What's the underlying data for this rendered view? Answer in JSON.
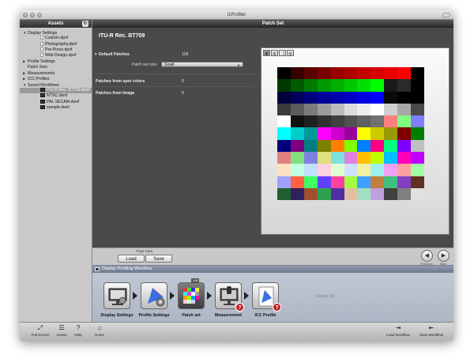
{
  "window": {
    "title": "i1Profiler"
  },
  "assets": {
    "header": "Assets",
    "refresh_icon": "↻",
    "tree": [
      {
        "label": "Display Settings",
        "indent": 0,
        "toggle": "▼",
        "icon": "none"
      },
      {
        "label": "Custom.dpxf",
        "indent": 2,
        "toggle": "",
        "icon": "file"
      },
      {
        "label": "Photography.dpxf",
        "indent": 2,
        "toggle": "",
        "icon": "file"
      },
      {
        "label": "Pre-Press.dpxf",
        "indent": 2,
        "toggle": "",
        "icon": "file"
      },
      {
        "label": "Web Design.dpxf",
        "indent": 2,
        "toggle": "",
        "icon": "file"
      },
      {
        "label": "Profile Settings",
        "indent": 0,
        "toggle": "▶",
        "icon": "none"
      },
      {
        "label": "Patch Sets",
        "indent": 0,
        "toggle": "",
        "icon": "none"
      },
      {
        "label": "Measurements",
        "indent": 0,
        "toggle": "▶",
        "icon": "none"
      },
      {
        "label": "ICC Profiles",
        "indent": 0,
        "toggle": "▶",
        "icon": "none"
      },
      {
        "label": "Saved Workflows",
        "indent": 0,
        "toggle": "▼",
        "icon": "none"
      },
      {
        "label": "ITU-R Rec. BT709.dwxf",
        "indent": 2,
        "toggle": "",
        "icon": "workflow",
        "selected": true
      },
      {
        "label": "NTSC.dwxf",
        "indent": 2,
        "toggle": "",
        "icon": "workflow"
      },
      {
        "label": "PAL SECAM.dwxf",
        "indent": 2,
        "toggle": "",
        "icon": "workflow"
      },
      {
        "label": "sample.dwxf",
        "indent": 2,
        "toggle": "",
        "icon": "workflow"
      }
    ]
  },
  "main": {
    "header": "Patch Set",
    "title": "ITU-R Rec. BT709",
    "default_patches": {
      "label": "Default Patches",
      "value": "118",
      "toggle": "▼"
    },
    "patch_set_size": {
      "label": "Patch set size:",
      "value": "Small",
      "caret": "▼"
    },
    "spot_colors": {
      "label": "Patches from spot colors",
      "value": "0"
    },
    "from_image": {
      "label": "Patches from Image",
      "value": "0"
    },
    "view_tabs": [
      "▦",
      "▥",
      "▕",
      "▤"
    ]
  },
  "patches": [
    "#000000",
    "#3a0000",
    "#5a0000",
    "#7a0000",
    "#9a0000",
    "#b00000",
    "#c60000",
    "#d80000",
    "#e80000",
    "#ff0000",
    "#000000",
    "#003a00",
    "#005a00",
    "#007a00",
    "#009a00",
    "#00b000",
    "#00c800",
    "#00e000",
    "#00ff00",
    "#1a1a1a",
    "#2a2a2a",
    "#000000",
    "#00003a",
    "#00005a",
    "#00007a",
    "#00009a",
    "#0000b0",
    "#0000c8",
    "#0000e0",
    "#0000ff",
    "#0a0a0a",
    "#000000",
    "#000000",
    "#3c3c3c",
    "#5c5c5c",
    "#7c7c7c",
    "#9c9c9c",
    "#bcbcbc",
    "#dcdcdc",
    "#ececec",
    "#ffffff",
    "#d0d0d0",
    "#a8a8a8",
    "#4a4a4a",
    "#ffffff",
    "#101010",
    "#202020",
    "#303030",
    "#404040",
    "#505050",
    "#606060",
    "#707070",
    "#ff7f7f",
    "#7fff7f",
    "#7f7fff",
    "#00ffff",
    "#00cccc",
    "#009999",
    "#ff00ff",
    "#cc00cc",
    "#990099",
    "#ffff00",
    "#cccc00",
    "#999900",
    "#7f0000",
    "#007f00",
    "#00007f",
    "#7f007f",
    "#007f7f",
    "#7f7f00",
    "#ff8000",
    "#80ff00",
    "#0080ff",
    "#ff0080",
    "#00ff80",
    "#8000ff",
    "#c0c0c0",
    "#e08080",
    "#80e080",
    "#8080e0",
    "#e0e080",
    "#80e0e0",
    "#e080e0",
    "#ffbf00",
    "#bfff00",
    "#00bfff",
    "#ff00bf",
    "#bf00ff",
    "#ffe0c0",
    "#c0ffe0",
    "#c0e0ff",
    "#ffd0e0",
    "#e0ffd0",
    "#d0e0ff",
    "#f0f0a0",
    "#a0f0f0",
    "#f0a0f0",
    "#ffa0a0",
    "#a0ffa0",
    "#a0a0ff",
    "#ff6040",
    "#40ff60",
    "#6040ff",
    "#ff40a0",
    "#a0ff40",
    "#40a0ff",
    "#c08040",
    "#40c080",
    "#8040c0",
    "#603020",
    "#206030",
    "#302060",
    "#a05030",
    "#30a050",
    "#5030a0",
    "#e0c0a0",
    "#a0e0c0",
    "#c0a0e0",
    "#404040",
    "#808080",
    "#e0e0e0"
  ],
  "pagebar": {
    "label": "Page Data",
    "load": "Load",
    "save": "Save",
    "previous_icon": "◀",
    "previous": "Previous",
    "next_icon": "▶",
    "next": "Next"
  },
  "workflow": {
    "title": "Display Profiling Workflow",
    "steps": [
      {
        "label": "Display Settings"
      },
      {
        "label": "Profile Settings"
      },
      {
        "label": "Patch set",
        "badge": "118"
      },
      {
        "label": "Measurement",
        "badge_q": "?"
      },
      {
        "label": "ICC Profile",
        "badge_q": "?"
      }
    ],
    "display_qa": "Display QA"
  },
  "bottombar": {
    "full_screen": "Full Screen",
    "assets": "Assets",
    "help": "Help",
    "home": "Home",
    "load_workflow": "Load Workflow",
    "save_workflow": "Save Workflow"
  }
}
